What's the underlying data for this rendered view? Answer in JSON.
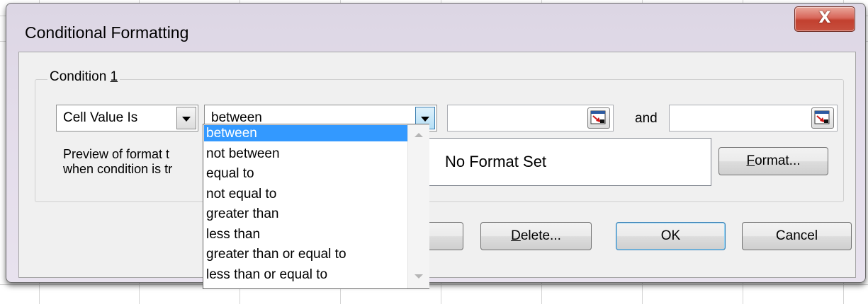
{
  "window": {
    "title": "Conditional Formatting",
    "close_label": "X"
  },
  "condition": {
    "group_label": "Condition ",
    "group_number": "1",
    "type_value": "Cell Value Is",
    "operator_value": "between",
    "value1": "",
    "and_label": "and",
    "value2": "",
    "preview_label_line1": "Preview of format t",
    "preview_label_line2": "when condition is tr",
    "preview_text": "No Format Set",
    "format_button": {
      "mnemonic": "F",
      "rest": "ormat..."
    }
  },
  "operator_options": [
    {
      "label": "between",
      "selected": true
    },
    {
      "label": "not between",
      "selected": false
    },
    {
      "label": "equal to",
      "selected": false
    },
    {
      "label": "not equal to",
      "selected": false
    },
    {
      "label": "greater than",
      "selected": false
    },
    {
      "label": "less than",
      "selected": false
    },
    {
      "label": "greater than or equal to",
      "selected": false
    },
    {
      "label": "less than or equal to",
      "selected": false
    }
  ],
  "buttons": {
    "delete": {
      "mnemonic": "D",
      "rest": "elete..."
    },
    "ok": "OK",
    "cancel": "Cancel"
  },
  "colors": {
    "selection": "#3399ff",
    "close_button": "#c7503f",
    "default_button_border": "#3c7fb1"
  },
  "icons": {
    "close": "close-icon",
    "dropdown": "chevron-down-icon",
    "range_select": "collapse-dialog-icon"
  }
}
